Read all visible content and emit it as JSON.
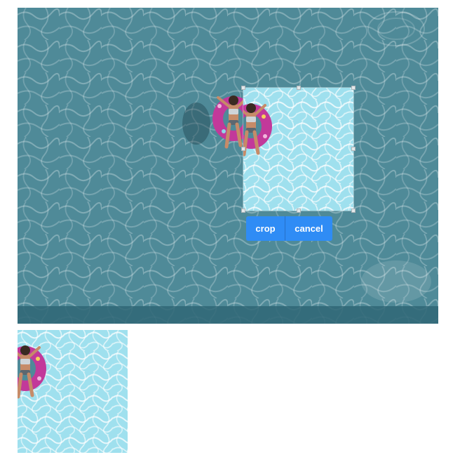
{
  "cropper": {
    "crop_label": "crop",
    "cancel_label": "cancel"
  },
  "colors": {
    "pool_water": "#4f8a98",
    "crop_highlight": "#9fe0ee",
    "float_ring": "#c2399a",
    "button_accent": "#2f8cf5"
  }
}
